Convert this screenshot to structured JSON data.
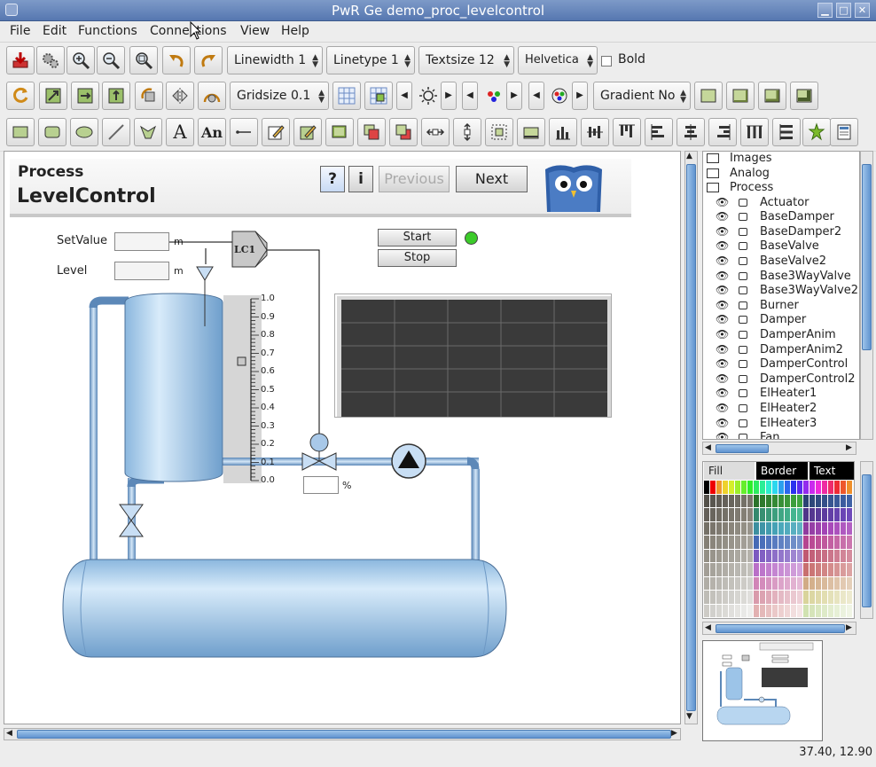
{
  "window": {
    "title": "PwR Ge   demo_proc_levelcontrol"
  },
  "menu": {
    "file": "File",
    "edit": "Edit",
    "functions": "Functions",
    "connections": "Connections",
    "view": "View",
    "help": "Help"
  },
  "toolbar1": {
    "linewidth": "Linewidth 1",
    "linetype": "Linetype 1",
    "textsize": "Textsize 12",
    "font": "Helvetica",
    "bold_label": "Bold"
  },
  "toolbar2": {
    "gridsize": "Gridsize 0.1",
    "gradient": "Gradient No"
  },
  "graph": {
    "header_process": "Process",
    "header_title": "LevelControl",
    "help_button": "?",
    "info_button": "i",
    "previous_button": "Previous",
    "next_button": "Next",
    "setvalue_label": "SetValue",
    "setvalue_unit": "m",
    "level_label": "Level",
    "level_unit": "m",
    "controller_label": "LC1",
    "start_button": "Start",
    "stop_button": "Stop",
    "valve_unit": "%",
    "indicator_color": "#3ccb2a",
    "scale_labels": [
      "1.0",
      "0.9",
      "0.8",
      "0.7",
      "0.6",
      "0.5",
      "0.4",
      "0.3",
      "0.2",
      "0.1",
      "0.0"
    ]
  },
  "tree": {
    "folders": [
      "Images",
      "Analog",
      "Process"
    ],
    "items": [
      "Actuator",
      "BaseDamper",
      "BaseDamper2",
      "BaseValve",
      "BaseValve2",
      "Base3WayValve",
      "Base3WayValve2",
      "Burner",
      "Damper",
      "DamperAnim",
      "DamperAnim2",
      "DamperControl",
      "DamperControl2",
      "ElHeater1",
      "ElHeater2",
      "ElHeater3",
      "Fan"
    ]
  },
  "palette": {
    "tab_fill": "Fill",
    "tab_border": "Border",
    "tab_text": "Text"
  },
  "status": {
    "coordinates": "37.40, 12.90"
  }
}
